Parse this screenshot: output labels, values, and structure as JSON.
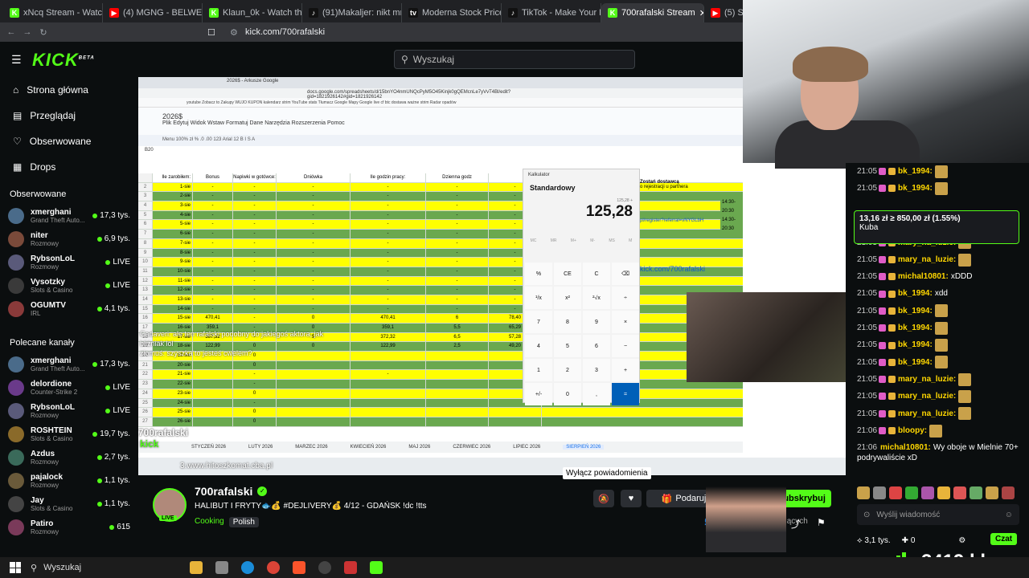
{
  "browser": {
    "tabs": [
      {
        "label": "xNcq Stream - Watch Live",
        "color": "#53fc18",
        "glyph": "K"
      },
      {
        "label": "(4) MGNG - BELWEDER (o",
        "color": "#ff0000",
        "glyph": "▶"
      },
      {
        "label": "Klaun_0k - Watch the VOD",
        "color": "#53fc18",
        "glyph": "K"
      },
      {
        "label": "(91)Makaljer: nikt mnie ni",
        "color": "#111",
        "glyph": "♪"
      },
      {
        "label": "Moderna Stock Price — M",
        "color": "#111",
        "glyph": "tv"
      },
      {
        "label": "TikTok - Make Your Day",
        "color": "#111",
        "glyph": "♪"
      },
      {
        "label": "700rafalski Stream",
        "color": "#53fc18",
        "glyph": "K",
        "active": true
      },
      {
        "label": "(5) Stuu",
        "color": "#ff0000",
        "glyph": "▶"
      }
    ],
    "url": "kick.com/700rafalski"
  },
  "kick": {
    "logo": "KICK",
    "logo_sup": "BETA",
    "search_placeholder": "Wyszukaj",
    "nav": [
      {
        "label": "Strona główna",
        "icon": "home-icon",
        "glyph": "⌂"
      },
      {
        "label": "Przeglądaj",
        "icon": "browse-icon",
        "glyph": "▤"
      },
      {
        "label": "Obserwowane",
        "icon": "heart-icon",
        "glyph": "♡"
      },
      {
        "label": "Drops",
        "icon": "drops-icon",
        "glyph": "▦"
      }
    ],
    "followed_header": "Obserwowane",
    "followed": [
      {
        "name": "xmerghani",
        "cat": "Grand Theft Auto...",
        "viewers": "17,3 tys.",
        "color": "#4a6b8a"
      },
      {
        "name": "niter",
        "cat": "Rozmowy",
        "viewers": "6,9 tys.",
        "color": "#7a4a3a"
      },
      {
        "name": "RybsonLoL",
        "cat": "Rozmowy",
        "viewers": "LIVE",
        "color": "#5a5a7a"
      },
      {
        "name": "Vysotzky",
        "cat": "Slots & Casino",
        "viewers": "LIVE",
        "color": "#3a3a3a"
      },
      {
        "name": "OGUMTV",
        "cat": "IRL",
        "viewers": "4,1 tys.",
        "color": "#8a3a3a"
      }
    ],
    "recommended_header": "Polecane kanały",
    "recommended": [
      {
        "name": "xmerghani",
        "cat": "Grand Theft Auto...",
        "viewers": "17,3 tys.",
        "color": "#4a6b8a"
      },
      {
        "name": "delordione",
        "cat": "Counter-Strike 2",
        "viewers": "LIVE",
        "color": "#6a3a8a"
      },
      {
        "name": "RybsonLoL",
        "cat": "Rozmowy",
        "viewers": "LIVE",
        "color": "#5a5a7a"
      },
      {
        "name": "ROSHTEIN",
        "cat": "Slots & Casino",
        "viewers": "19,7 tys.",
        "color": "#8a6a2a"
      },
      {
        "name": "Azdus",
        "cat": "Rozmowy",
        "viewers": "2,7 tys.",
        "color": "#3a6a5a"
      },
      {
        "name": "pajalock",
        "cat": "Rozmowy",
        "viewers": "1,1 tys.",
        "color": "#6a5a3a"
      },
      {
        "name": "Jay",
        "cat": "Slots & Casino",
        "viewers": "1,1 tys.",
        "color": "#444"
      },
      {
        "name": "Patiro",
        "cat": "Rozmowy",
        "viewers": "615",
        "color": "#7a3a5a"
      }
    ]
  },
  "stream_overlay": {
    "chat_overlay_1": "Cadaveri: ale ten rafalski podobny do jakiegoś  aktora, jak bliźniak lol",
    "chat_overlay_2": "ziomuś: szyszka to jesteś cwelem?",
    "watermark": "700rafalski",
    "kick_word": "kick",
    "url_text": "3.www.hitoszkomat.cba.pl"
  },
  "spreadsheet": {
    "tab_title": "2026$ - Arkusze Google",
    "url": "docs.google.com/spreadsheets/d/15bnYO4nmUNQcPyM5O45Kinjk0gQEMcnLe7yVvT4Bl/edit?gid=1821926142#gid=1821926142",
    "bookmarks": "youtube  Zobacz to  Zakupy  WUJO KUPON  kalendarz strim  YouTube  stats  Tłumacz Google  Mapy Google  live  cf  btc  dostawa  ważne strim  Radar opadów",
    "doc_title": "2026$",
    "menu": "Plik  Edytuj  Widok  Wstaw  Formatuj  Dane  Narzędzia  Rozszerzenia  Pomoc",
    "toolbar": "Menu   100%   zł  %  .0  .00  123   Arial   12   B  I  S  A",
    "cell_ref": "B20",
    "headers": [
      "",
      "Ile zarobiłem:",
      "Bonus (wyzwania):",
      "Napiwki w gotówce:",
      "Dniówka",
      "Ile godzin pracy:",
      "Dzienna godz"
    ],
    "rows": [
      [
        "1-sie",
        "-",
        "-",
        "-",
        "-",
        "-",
        "-"
      ],
      [
        "2-sie",
        "-",
        "-",
        "-",
        "-",
        "-",
        "-"
      ],
      [
        "3-sie",
        "-",
        "-",
        "-",
        "-",
        "-",
        "-"
      ],
      [
        "4-sie",
        "-",
        "-",
        "-",
        "-",
        "-",
        "-"
      ],
      [
        "5-sie",
        "-",
        "-",
        "-",
        "-",
        "-",
        "-"
      ],
      [
        "6-sie",
        "-",
        "-",
        "-",
        "-",
        "-",
        "-"
      ],
      [
        "7-sie",
        "-",
        "-",
        "-",
        "-",
        "-",
        "-"
      ],
      [
        "8-sie",
        "-",
        "-",
        "-",
        "-",
        "-",
        "-"
      ],
      [
        "9-sie",
        "-",
        "-",
        "-",
        "-",
        "-",
        "-"
      ],
      [
        "10-sie",
        "-",
        "-",
        "-",
        "-",
        "-",
        "-"
      ],
      [
        "11-sie",
        "-",
        "-",
        "-",
        "-",
        "-",
        "-"
      ],
      [
        "12-sie",
        "-",
        "-",
        "-",
        "-",
        "-",
        "-"
      ],
      [
        "13-sie",
        "-",
        "-",
        "-",
        "-",
        "-",
        "-"
      ],
      [
        "14-sie",
        "-",
        "-",
        "-",
        "-",
        "-",
        "-"
      ],
      [
        "15-sie",
        "470,41",
        "-",
        "0",
        "470,41",
        "6",
        "78,40"
      ],
      [
        "16-sie",
        "359,1",
        "-",
        "0",
        "359,1",
        "5,5",
        "65,29"
      ],
      [
        "17-sie",
        "367,32",
        "-",
        "5",
        "372,32",
        "6,5",
        "57,28"
      ],
      [
        "18-sie",
        "122,99",
        "0",
        "0",
        "122,99",
        "2,5",
        "49,20"
      ],
      [
        "19-sie",
        "",
        "0",
        "",
        "",
        "",
        ""
      ],
      [
        "20-sie",
        "",
        "0",
        "",
        "",
        "",
        ""
      ],
      [
        "21-sie",
        "",
        "-",
        "",
        "-",
        "",
        ""
      ],
      [
        "22-sie",
        "",
        "-",
        "",
        "",
        "",
        ""
      ],
      [
        "23-sie",
        "",
        "0",
        "",
        "",
        "",
        ""
      ],
      [
        "24-sie",
        "",
        "-",
        "",
        "",
        "",
        ""
      ],
      [
        "25-sie",
        "",
        "0",
        "",
        "",
        "",
        ""
      ],
      [
        "26-sie",
        "",
        "0",
        "",
        "",
        "",
        ""
      ]
    ],
    "sheet_tabs": [
      "STYCZEŃ 2026",
      "LUTY 2026",
      "MARZEC 2026",
      "KWIECIEŃ 2026",
      "MAJ 2026",
      "CZERWIEC 2026",
      "LIPIEC 2026",
      "SIERPIEŃ 2026"
    ],
    "delivery_note": "Zostań dostawcą",
    "delivery_sub": "o rejestracji u partnera",
    "register_link": "pl/register?referral=vNYGLbH",
    "hours_1": "14:30-20:30",
    "hours_2": "14:30-20:30",
    "kick_link": "kick.com/700rafalski"
  },
  "calculator": {
    "title": "Kalkulator",
    "mode": "Standardowy",
    "prev": "125,28 +",
    "result": "125,28",
    "memory": [
      "MC",
      "MR",
      "M+",
      "M-",
      "MS",
      "M"
    ],
    "keys": [
      "%",
      "CE",
      "C",
      "⌫",
      "¹/x",
      "x²",
      "²√x",
      "÷",
      "7",
      "8",
      "9",
      "×",
      "4",
      "5",
      "6",
      "−",
      "1",
      "2",
      "3",
      "+",
      "+/-",
      "0",
      ",",
      "="
    ]
  },
  "chat": {
    "pinned_line1": "13,16 zł ≥ 850,00 zł (1.55%)",
    "pinned_line2": "Kuba",
    "messages": [
      {
        "time": "21:05",
        "user": "bk_1994:",
        "color": "#ffd700",
        "text": "",
        "emote": true
      },
      {
        "time": "21:05",
        "user": "bk_1994:",
        "color": "#ffd700",
        "text": "",
        "emote": true
      },
      {
        "time": "21:05",
        "user": "mary_na_luzie:",
        "color": "#ffd700",
        "text": "",
        "emote": true
      },
      {
        "time": "21:05",
        "user": "mary_na_luzie:",
        "color": "#ffd700",
        "text": "",
        "emote": true
      },
      {
        "time": "21:05",
        "user": "michal10801:",
        "color": "#ffd700",
        "text": "xDDD",
        "emote": false
      },
      {
        "time": "21:05",
        "user": "bk_1994:",
        "color": "#ffd700",
        "text": "xdd",
        "emote": false
      },
      {
        "time": "21:05",
        "user": "bk_1994:",
        "color": "#ffd700",
        "text": "",
        "emote": true
      },
      {
        "time": "21:05",
        "user": "bk_1994:",
        "color": "#ffd700",
        "text": "",
        "emote": true
      },
      {
        "time": "21:05",
        "user": "bk_1994:",
        "color": "#ffd700",
        "text": "",
        "emote": true
      },
      {
        "time": "21:05",
        "user": "bk_1994:",
        "color": "#ffd700",
        "text": "",
        "emote": true
      },
      {
        "time": "21:05",
        "user": "mary_na_luzie:",
        "color": "#ffd700",
        "text": "",
        "emote": true
      },
      {
        "time": "21:05",
        "user": "mary_na_luzie:",
        "color": "#ffd700",
        "text": "",
        "emote": true
      },
      {
        "time": "21:05",
        "user": "mary_na_luzie:",
        "color": "#ffd700",
        "text": "",
        "emote": true
      },
      {
        "time": "21:06",
        "user": "bloopy:",
        "color": "#ffd700",
        "text": "",
        "emote": true
      }
    ],
    "last_msg_time": "21:06",
    "last_msg_user": "michal10801:",
    "last_msg_text": "Wy oboje w Mielnie 70+ podrywaliście xD",
    "input_placeholder": "Wyślij wiadomość",
    "points": "3,1 tys.",
    "zero": "0",
    "czat_button": "Czat",
    "bitrate": "3419 kbps"
  },
  "streamer": {
    "name": "700rafalski",
    "title": "HALIBUT I  FRYTY🐟💰 #DEJLIVERY💰 4/12 - GDAŃSK !dc !tts",
    "category": "Cooking",
    "tag": "Polish",
    "live": "LIVE",
    "tooltip": "Wyłącz powiadomienia",
    "gift_label": "Podaruj subskry",
    "sub_label": "Subskrybuj",
    "viewers": "126",
    "viewers_suffix": "ących"
  },
  "os": {
    "search": "Wyszukaj"
  }
}
